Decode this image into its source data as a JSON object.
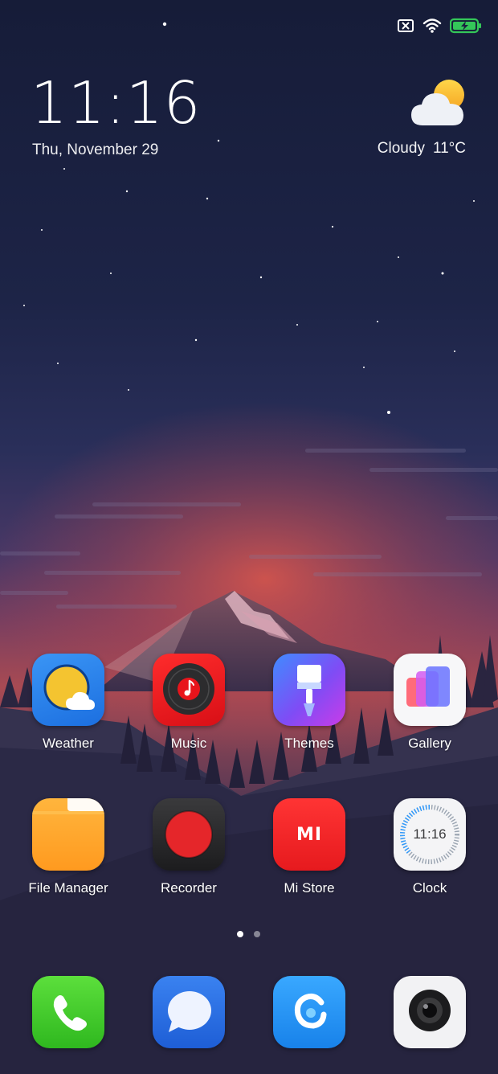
{
  "status_bar": {
    "sim_icon": "sim-none-icon",
    "wifi_icon": "wifi-icon",
    "battery_icon": "battery-charging-icon",
    "battery_color": "#34c759"
  },
  "clock_widget": {
    "time": "11:16",
    "date": "Thu, November 29"
  },
  "weather_widget": {
    "icon": "partly-cloudy-icon",
    "condition": "Cloudy",
    "temperature": "11°C"
  },
  "apps": [
    {
      "label": "Weather",
      "icon": "weather-icon"
    },
    {
      "label": "Music",
      "icon": "music-icon"
    },
    {
      "label": "Themes",
      "icon": "themes-icon"
    },
    {
      "label": "Gallery",
      "icon": "gallery-icon"
    },
    {
      "label": "File Manager",
      "icon": "folder-icon"
    },
    {
      "label": "Recorder",
      "icon": "recorder-icon"
    },
    {
      "label": "Mi Store",
      "icon": "mi-store-icon",
      "text": "MI"
    },
    {
      "label": "Clock",
      "icon": "clock-icon",
      "text": "11:16"
    }
  ],
  "page_indicator": {
    "pages": 2,
    "current": 1
  },
  "dock": [
    {
      "icon": "phone-icon"
    },
    {
      "icon": "messages-icon"
    },
    {
      "icon": "browser-icon"
    },
    {
      "icon": "camera-icon"
    }
  ]
}
